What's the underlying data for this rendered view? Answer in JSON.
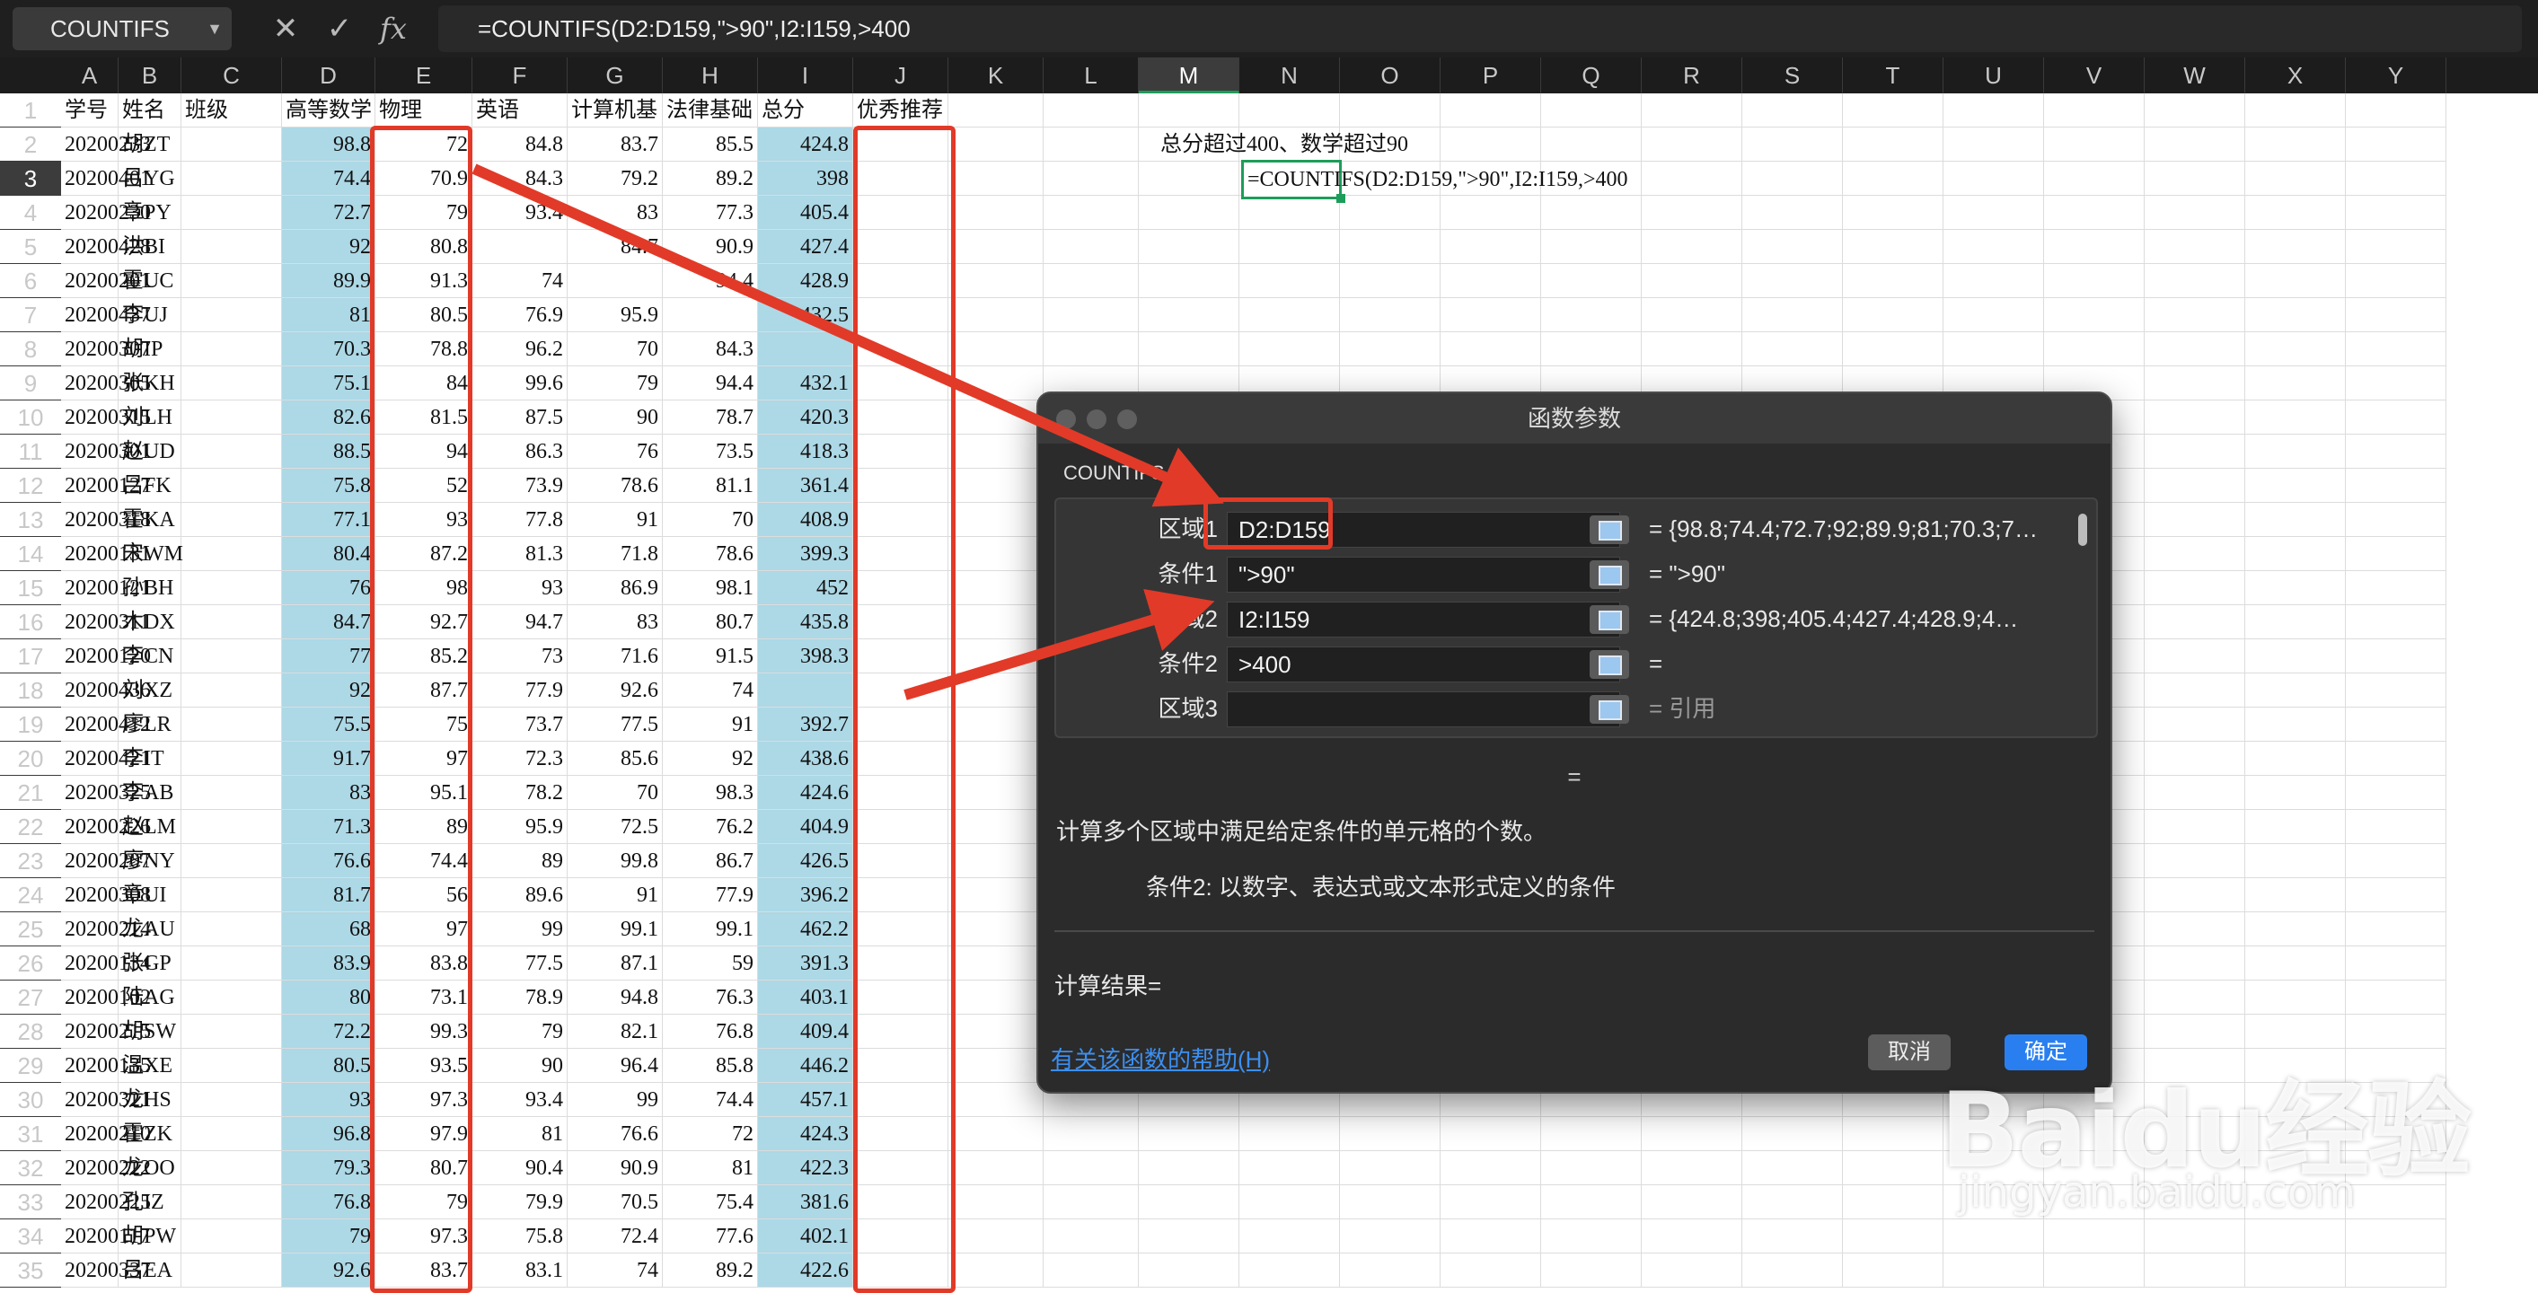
{
  "formula_bar": {
    "name_box": "COUNTIFS",
    "cancel_icon": "✕",
    "enter_icon": "✓",
    "fx_icon": "fx",
    "formula": "=COUNTIFS(D2:D159,\">90\",I2:I159,>400"
  },
  "columns": [
    "A",
    "B",
    "C",
    "D",
    "E",
    "F",
    "G",
    "H",
    "I",
    "J",
    "K",
    "L",
    "M",
    "N",
    "O",
    "P",
    "Q",
    "R",
    "S",
    "T",
    "U",
    "V",
    "W",
    "X",
    "Y"
  ],
  "selected_column": "M",
  "rows": [
    [
      "学号",
      "姓名",
      "班级",
      "高等数学",
      "物理",
      "英语",
      "计算机基",
      "法律基础",
      "总分",
      "优秀推荐"
    ],
    [
      "20200233",
      "胡ZT",
      "",
      "98.8",
      "72",
      "84.8",
      "83.7",
      "85.5",
      "424.8",
      ""
    ],
    [
      "20200401",
      "吕YG",
      "",
      "74.4",
      "70.9",
      "84.3",
      "79.2",
      "89.2",
      "398",
      ""
    ],
    [
      "20200230",
      "章PY",
      "",
      "72.7",
      "79",
      "93.4",
      "83",
      "77.3",
      "405.4",
      ""
    ],
    [
      "20200428",
      "洪BI",
      "",
      "92",
      "80.8",
      "",
      "84.7",
      "90.9",
      "427.4",
      ""
    ],
    [
      "20200201",
      "霍UC",
      "",
      "89.9",
      "91.3",
      "74",
      "",
      "94.4",
      "428.9",
      ""
    ],
    [
      "20200437",
      "李UJ",
      "",
      "81",
      "80.5",
      "76.9",
      "95.9",
      "",
      "432.5",
      ""
    ],
    [
      "20200307",
      "胡IP",
      "",
      "70.3",
      "78.8",
      "96.2",
      "70",
      "84.3",
      "",
      ""
    ],
    [
      "20200305",
      "张KH",
      "",
      "75.1",
      "84",
      "99.6",
      "79",
      "94.4",
      "432.1",
      ""
    ],
    [
      "20200315",
      "刘LH",
      "",
      "82.6",
      "81.5",
      "87.5",
      "90",
      "78.7",
      "420.3",
      ""
    ],
    [
      "20200301",
      "赵UD",
      "",
      "88.5",
      "94",
      "86.3",
      "76",
      "73.5",
      "418.3",
      ""
    ],
    [
      "20200127",
      "吕FK",
      "",
      "75.8",
      "52",
      "73.9",
      "78.6",
      "81.1",
      "361.4",
      ""
    ],
    [
      "20200318",
      "霍KA",
      "",
      "77.1",
      "93",
      "77.8",
      "91",
      "70",
      "408.9",
      ""
    ],
    [
      "20200131",
      "宋WM",
      "",
      "80.4",
      "87.2",
      "81.3",
      "71.8",
      "78.6",
      "399.3",
      ""
    ],
    [
      "20200121",
      "孙BH",
      "",
      "76",
      "98",
      "93",
      "86.9",
      "98.1",
      "452",
      ""
    ],
    [
      "20200311",
      "木DX",
      "",
      "84.7",
      "92.7",
      "94.7",
      "83",
      "80.7",
      "435.8",
      ""
    ],
    [
      "20200120",
      "李CN",
      "",
      "77",
      "85.2",
      "73",
      "71.6",
      "91.5",
      "398.3",
      ""
    ],
    [
      "20200436",
      "刘XZ",
      "",
      "92",
      "87.7",
      "77.9",
      "92.6",
      "74",
      "",
      ""
    ],
    [
      "20200412",
      "廖LR",
      "",
      "75.5",
      "75",
      "73.7",
      "77.5",
      "91",
      "392.7",
      ""
    ],
    [
      "20200421",
      "李IT",
      "",
      "91.7",
      "97",
      "72.3",
      "85.6",
      "92",
      "438.6",
      ""
    ],
    [
      "20200325",
      "李AB",
      "",
      "83",
      "95.1",
      "78.2",
      "70",
      "98.3",
      "424.6",
      ""
    ],
    [
      "20200226",
      "赵LM",
      "",
      "71.3",
      "89",
      "95.9",
      "72.5",
      "76.2",
      "404.9",
      ""
    ],
    [
      "20200207",
      "廖NY",
      "",
      "76.6",
      "74.4",
      "89",
      "99.8",
      "86.7",
      "426.5",
      ""
    ],
    [
      "20200308",
      "章UI",
      "",
      "81.7",
      "56",
      "89.6",
      "91",
      "77.9",
      "396.2",
      ""
    ],
    [
      "20200214",
      "龙AU",
      "",
      "68",
      "97",
      "99",
      "99.1",
      "99.1",
      "462.2",
      ""
    ],
    [
      "20200134",
      "张GP",
      "",
      "83.9",
      "83.8",
      "77.5",
      "87.1",
      "59",
      "391.3",
      ""
    ],
    [
      "20200102",
      "陆AG",
      "",
      "80",
      "73.1",
      "78.9",
      "94.8",
      "76.3",
      "403.1",
      ""
    ],
    [
      "20200215",
      "胡SW",
      "",
      "72.2",
      "99.3",
      "79",
      "82.1",
      "76.8",
      "409.4",
      ""
    ],
    [
      "20200135",
      "温XE",
      "",
      "80.5",
      "93.5",
      "90",
      "96.4",
      "85.8",
      "446.2",
      ""
    ],
    [
      "20200321",
      "龙HS",
      "",
      "93",
      "97.3",
      "93.4",
      "99",
      "74.4",
      "457.1",
      ""
    ],
    [
      "20200210",
      "霍ZK",
      "",
      "96.8",
      "97.9",
      "81",
      "76.6",
      "72",
      "424.3",
      ""
    ],
    [
      "20200222",
      "龙OO",
      "",
      "79.3",
      "80.7",
      "90.4",
      "90.9",
      "81",
      "422.3",
      ""
    ],
    [
      "20200225",
      "孔IZ",
      "",
      "76.8",
      "79",
      "79.9",
      "70.5",
      "75.4",
      "381.6",
      ""
    ],
    [
      "20200117",
      "胡PW",
      "",
      "79",
      "97.3",
      "75.8",
      "72.4",
      "77.6",
      "402.1",
      ""
    ],
    [
      "20200337",
      "吕EA",
      "",
      "92.6",
      "83.7",
      "83.1",
      "74",
      "89.2",
      "422.6",
      ""
    ]
  ],
  "note_cell": "总分超过400、数学超过90",
  "editing_cell": "=COUNTIFS(D2:D159,\">90\",I2:I159,>400",
  "dialog": {
    "title": "函数参数",
    "function_name": "COUNTIFS",
    "args": [
      {
        "label": "区域1",
        "value": "D2:D159",
        "preview": "= {98.8;74.4;72.7;92;89.9;81;70.3;7…"
      },
      {
        "label": "条件1",
        "value": "\">90\"",
        "preview": "= \">90\""
      },
      {
        "label": "区域2",
        "value": "I2:I159",
        "preview": "= {424.8;398;405.4;427.4;428.9;4…"
      },
      {
        "label": "条件2",
        "value": ">400",
        "preview": "="
      },
      {
        "label": "区域3",
        "value": "",
        "preview": "= 引用"
      }
    ],
    "equals": "=",
    "description": "计算多个区域中满足给定条件的单元格的个数。",
    "arg_description": "条件2:  以数字、表达式或文本形式定义的条件",
    "result_label": "计算结果=",
    "help_link": "有关该函数的帮助(H)",
    "cancel": "取消",
    "ok": "确定"
  },
  "watermark": {
    "brand": "Baidu经验",
    "url": "jingyan.baidu.com"
  },
  "colors": {
    "highlight": "#add8e6",
    "annotation_red": "#e23a28",
    "accent_green": "#1d9d5a",
    "ok_blue": "#2a7ff0"
  }
}
